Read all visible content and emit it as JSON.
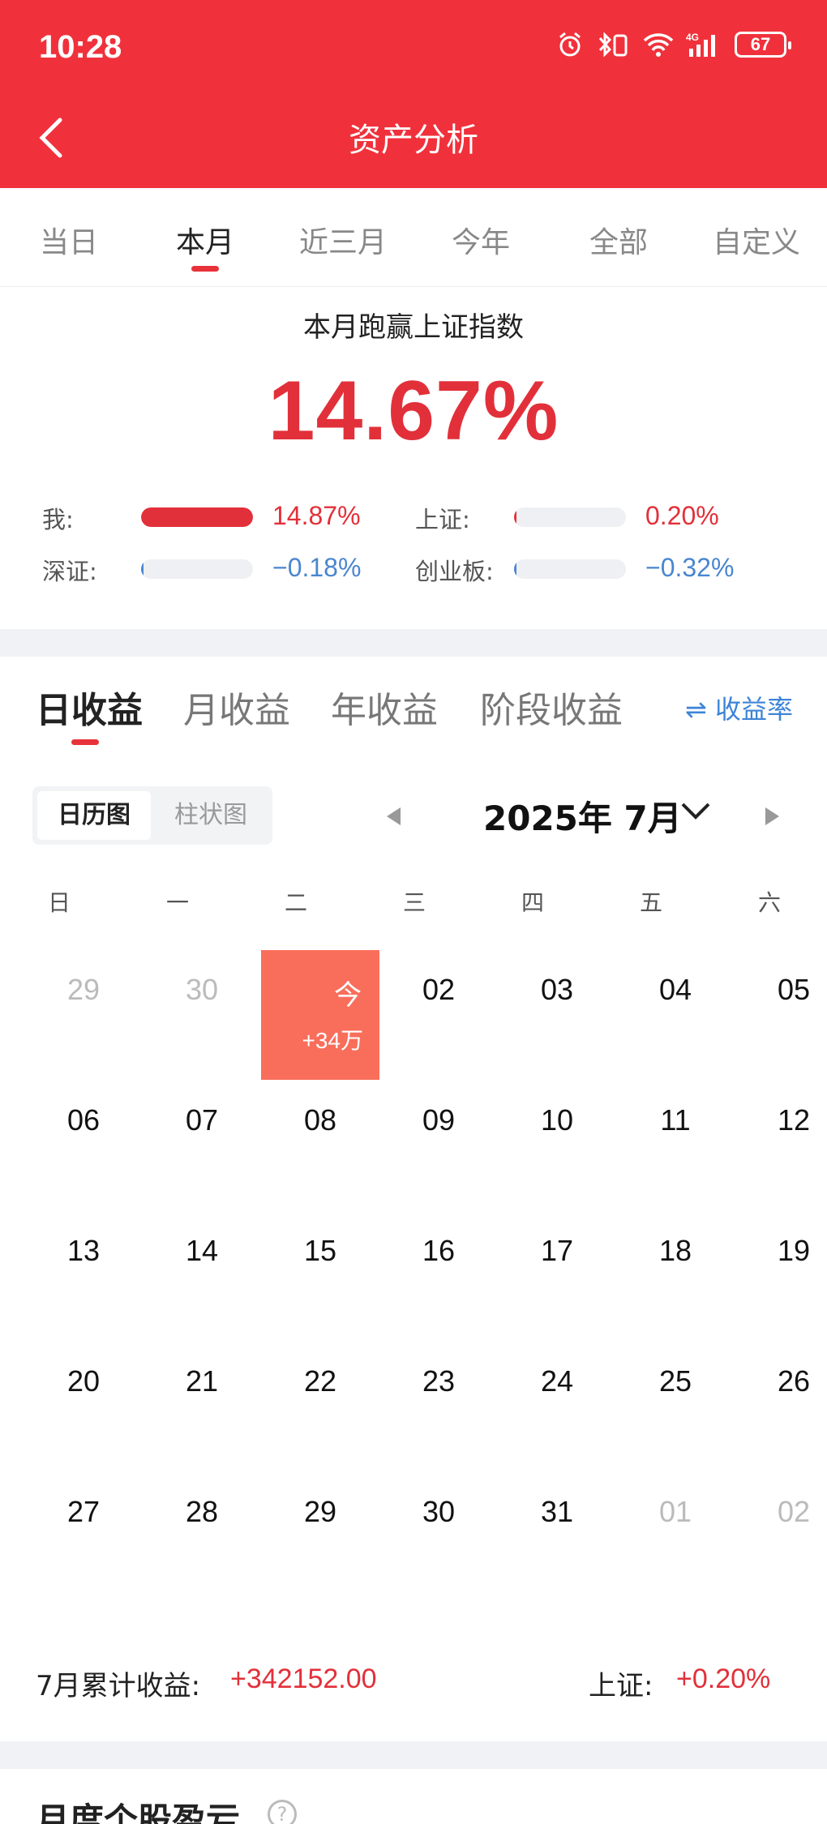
{
  "status_bar": {
    "time": "10:28",
    "battery": "67"
  },
  "header": {
    "title": "资产分析"
  },
  "period_tabs": [
    {
      "label": "当日"
    },
    {
      "label": "本月"
    },
    {
      "label": "近三月"
    },
    {
      "label": "今年"
    },
    {
      "label": "全部"
    },
    {
      "label": "自定义"
    }
  ],
  "active_period": "本月",
  "summary": {
    "title": "本月跑赢上证指数",
    "outperform_pct": "14.67%",
    "comparisons": [
      {
        "label": "我:",
        "value": "14.87%",
        "fill": 1.0,
        "color": "#e2303a"
      },
      {
        "label": "上证:",
        "value": "0.20%",
        "fill": 0.013,
        "color": "#e2303a"
      },
      {
        "label": "深证:",
        "value": "−0.18%",
        "fill": 0.012,
        "color": "#4a86cf"
      },
      {
        "label": "创业板:",
        "value": "−0.32%",
        "fill": 0.022,
        "color": "#4a86cf"
      }
    ]
  },
  "profit_tabs": [
    {
      "label": "日收益"
    },
    {
      "label": "月收益"
    },
    {
      "label": "年收益"
    },
    {
      "label": "阶段收益"
    }
  ],
  "active_profit_tab": "日收益",
  "rate_link": "⇌ 收益率",
  "view_toggle": {
    "calendar": "日历图",
    "bar": "柱状图",
    "active": "日历图"
  },
  "month": {
    "label": "2025年 7月"
  },
  "calendar": {
    "weekdays": [
      "日",
      "一",
      "二",
      "三",
      "四",
      "五",
      "六"
    ],
    "weeks": [
      [
        {
          "d": "29",
          "dim": true
        },
        {
          "d": "30",
          "dim": true
        },
        {
          "d": "今",
          "today": true,
          "sub": "+34万"
        },
        {
          "d": "02"
        },
        {
          "d": "03"
        },
        {
          "d": "04"
        },
        {
          "d": "05"
        }
      ],
      [
        {
          "d": "06"
        },
        {
          "d": "07"
        },
        {
          "d": "08"
        },
        {
          "d": "09"
        },
        {
          "d": "10"
        },
        {
          "d": "11"
        },
        {
          "d": "12"
        }
      ],
      [
        {
          "d": "13"
        },
        {
          "d": "14"
        },
        {
          "d": "15"
        },
        {
          "d": "16"
        },
        {
          "d": "17"
        },
        {
          "d": "18"
        },
        {
          "d": "19"
        }
      ],
      [
        {
          "d": "20"
        },
        {
          "d": "21"
        },
        {
          "d": "22"
        },
        {
          "d": "23"
        },
        {
          "d": "24"
        },
        {
          "d": "25"
        },
        {
          "d": "26"
        }
      ],
      [
        {
          "d": "27"
        },
        {
          "d": "28"
        },
        {
          "d": "29"
        },
        {
          "d": "30"
        },
        {
          "d": "31"
        },
        {
          "d": "01",
          "dim": true
        },
        {
          "d": "02",
          "dim": true
        }
      ]
    ]
  },
  "footer": {
    "cum_label": "7月累计收益:",
    "cum_value": "+342152.00",
    "index_label": "上证:",
    "index_value": "+0.20%"
  },
  "next_section": {
    "title": "月度个股盈亏"
  },
  "colors": {
    "brand_red": "#f0313b",
    "up": "#e2303a",
    "down": "#4a86cf",
    "today_cell": "#f86e5b"
  }
}
